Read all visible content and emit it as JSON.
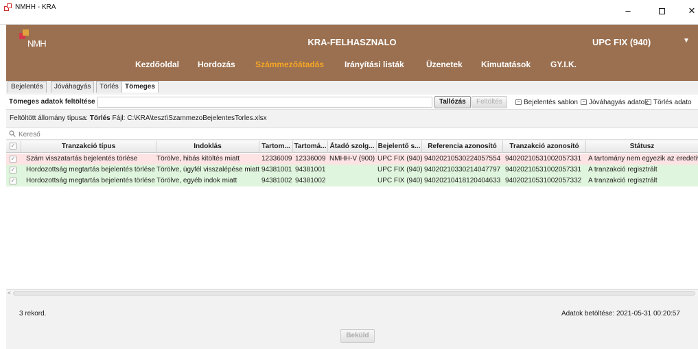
{
  "window": {
    "title": "NMHH - KRA",
    "minimize": "–",
    "close": "✕"
  },
  "header": {
    "logo_text": "NMH",
    "user": "KRA-FELHASZNALO",
    "organization": "UPC FIX (940)",
    "nav": [
      {
        "label": "Kezdőoldal",
        "active": false
      },
      {
        "label": "Hordozás",
        "active": false
      },
      {
        "label": "Számmezőátadás",
        "active": true
      },
      {
        "label": "Irányítási listák",
        "active": false
      },
      {
        "label": "Üzenetek",
        "active": false
      },
      {
        "label": "Kimutatások",
        "active": false
      },
      {
        "label": "GY.I.K.",
        "active": false
      }
    ],
    "colors": {
      "background": "#9b7050",
      "active_nav": "#f5a623"
    }
  },
  "tabs": [
    {
      "label": "Bejelentés"
    },
    {
      "label": "Jóváhagyás"
    },
    {
      "label": "Törlés"
    },
    {
      "label": "Tömeges",
      "active": true
    }
  ],
  "upload": {
    "label": "Tömeges adatok feltöltése",
    "value": "",
    "browse": "Tallózás",
    "upload": "Feltöltés",
    "links": [
      "Bejelentés sablon",
      "Jóváhagyás adatok",
      "Törlés adato"
    ]
  },
  "info": {
    "type_label": "Feltöltött állomány típusa:",
    "type_value": "Törlés",
    "file_label": "Fájl:",
    "file_value": "C:\\KRA\\teszt\\SzammezoBejelentesTorles.xlsx"
  },
  "search": {
    "placeholder": "Kereső"
  },
  "table": {
    "columns": [
      "Tranzakció típus",
      "Indoklás",
      "Tartom...",
      "Tartomá...",
      "Átadó szolg...",
      "Bejelentő s...",
      "Referencia azonosító",
      "Tranzakció azonosító",
      "Státusz"
    ],
    "rows": [
      {
        "status": "err",
        "cells": [
          "Szám visszatartás bejelentés törlése",
          "Törölve, hibás kitöltés miatt",
          "12336009",
          "12336009",
          "NMHH-V (900)",
          "UPC FIX (940)",
          "94020210530224057554",
          "94020210531002057331",
          "A tartomány nem egyezik az eredetivel"
        ]
      },
      {
        "status": "ok",
        "cells": [
          "Hordozottság megtartás bejelentés törlése",
          "Törölve, ügyfél visszalépése miatt",
          "94381001",
          "94381001",
          "",
          "UPC FIX (940)",
          "94020210330214047797",
          "94020210531002057331",
          "A tranzakció regisztrált"
        ]
      },
      {
        "status": "ok",
        "cells": [
          "Hordozottság megtartás bejelentés törlése",
          "Törölve, egyéb indok miatt",
          "94381002",
          "94381002",
          "",
          "UPC FIX (940)",
          "94020210418120404633",
          "94020210531002057332",
          "A tranzakció regisztrált"
        ]
      }
    ]
  },
  "footer": {
    "records": "3 rekord.",
    "loaded": "Adatok betöltése: 2021-05-31 00:20:57",
    "submit": "Beküld"
  }
}
